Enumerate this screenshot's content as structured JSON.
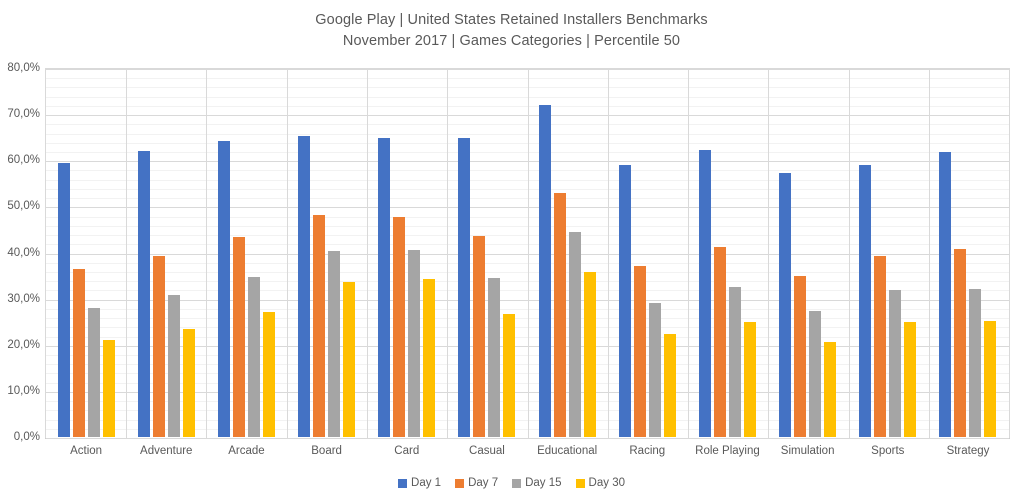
{
  "chart_data": {
    "type": "bar",
    "title": "Google Play | United States Retained Installers Benchmarks",
    "subtitle": "November 2017 | Games Categories | Percentile 50",
    "xlabel": "",
    "ylabel": "",
    "ylim": [
      0,
      80
    ],
    "ytick_step": 10,
    "minor_gridline_step": 2,
    "grid": true,
    "legend_position": "bottom",
    "value_format": "percent_comma_one_decimal",
    "categories": [
      "Action",
      "Adventure",
      "Arcade",
      "Board",
      "Card",
      "Casual",
      "Educational",
      "Racing",
      "Role Playing",
      "Simulation",
      "Sports",
      "Strategy"
    ],
    "ytick_labels": [
      "0,0%",
      "10,0%",
      "20,0%",
      "30,0%",
      "40,0%",
      "50,0%",
      "60,0%",
      "70,0%",
      "80,0%"
    ],
    "ytick_values": [
      0,
      10,
      20,
      30,
      40,
      50,
      60,
      70,
      80
    ],
    "series": [
      {
        "name": "Day 1",
        "color": "#4472C4",
        "values": [
          59.6,
          62.1,
          64.4,
          65.4,
          65.1,
          65.0,
          72.2,
          59.2,
          62.3,
          57.4,
          59.2,
          61.9
        ]
      },
      {
        "name": "Day 7",
        "color": "#ED7D31",
        "values": [
          36.5,
          39.3,
          43.5,
          48.2,
          47.9,
          43.6,
          53.1,
          37.1,
          41.4,
          35.1,
          39.3,
          40.9
        ]
      },
      {
        "name": "Day 15",
        "color": "#A5A5A5",
        "values": [
          28.1,
          30.8,
          34.8,
          40.5,
          40.7,
          34.5,
          44.6,
          29.2,
          32.6,
          27.3,
          31.9,
          32.2
        ]
      },
      {
        "name": "Day 30",
        "color": "#FFC000",
        "values": [
          21.1,
          23.5,
          27.2,
          33.8,
          34.4,
          26.8,
          35.9,
          22.4,
          24.9,
          20.6,
          24.9,
          25.2
        ]
      }
    ]
  }
}
